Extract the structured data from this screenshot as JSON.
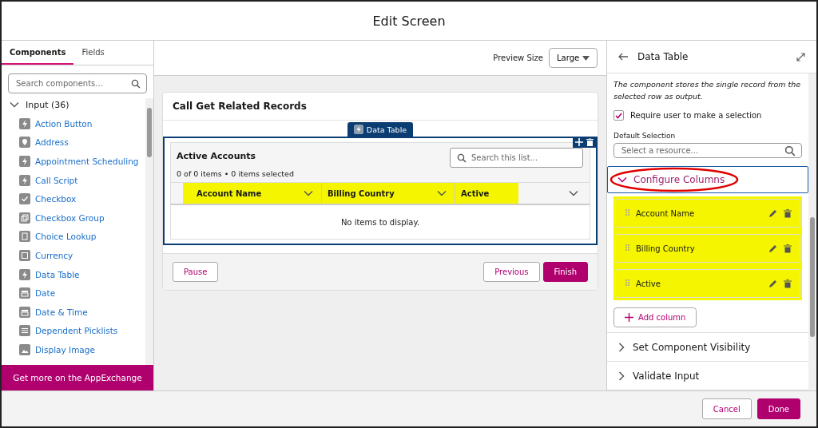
{
  "window": {
    "title": "Edit Screen"
  },
  "tabs": [
    {
      "label": "Components",
      "selected": true
    },
    {
      "label": "Fields",
      "selected": false
    }
  ],
  "sidebar": {
    "search": {
      "placeholder": "Search components..."
    },
    "group": {
      "label": "Input (36)",
      "expanded": true,
      "items": [
        {
          "label": "Action Button",
          "kind": "bolt"
        },
        {
          "label": "Address",
          "kind": "pin"
        },
        {
          "label": "Appointment Scheduling",
          "kind": "bolt"
        },
        {
          "label": "Call Script",
          "kind": "bolt"
        },
        {
          "label": "Checkbox",
          "kind": "check"
        },
        {
          "label": "Checkbox Group",
          "kind": "group"
        },
        {
          "label": "Choice Lookup",
          "kind": "clipboard"
        },
        {
          "label": "Currency",
          "kind": "square"
        },
        {
          "label": "Data Table",
          "kind": "bolt"
        },
        {
          "label": "Date",
          "kind": "calendar"
        },
        {
          "label": "Date & Time",
          "kind": "calendar"
        },
        {
          "label": "Dependent Picklists",
          "kind": "list"
        },
        {
          "label": "Display Image",
          "kind": "image"
        }
      ]
    },
    "footer": "Get more on the AppExchange"
  },
  "preview": {
    "label": "Preview Size",
    "value": "Large"
  },
  "screen": {
    "title": "Call Get Related Records",
    "badge": "Data Table",
    "table": {
      "title": "Active Accounts",
      "summary": "0 of 0 items • 0 items selected",
      "search": {
        "placeholder": "Search this list..."
      },
      "columns": [
        {
          "label": "Account Name",
          "highlighted": true
        },
        {
          "label": "Billing Country",
          "highlighted": true
        },
        {
          "label": "Active",
          "highlighted": true
        }
      ],
      "empty": "No items to display."
    },
    "buttons": [
      {
        "label": "Pause",
        "kind": "outline"
      },
      {
        "label": "Previous",
        "kind": "outline"
      },
      {
        "label": "Finish",
        "kind": "brand"
      }
    ]
  },
  "properties": {
    "title": "Data Table",
    "note": "The component stores the single record from the selected row as output.",
    "require": {
      "label": "Require user to make a selection",
      "checked": true
    },
    "default_selection": {
      "label": "Default Selection",
      "placeholder": "Select a resource..."
    },
    "sections": [
      {
        "label": "Configure Columns",
        "expanded": true,
        "circled": true,
        "columns": [
          {
            "label": "Account Name",
            "highlighted": true
          },
          {
            "label": "Billing Country",
            "highlighted": true
          },
          {
            "label": "Active",
            "highlighted": true
          }
        ],
        "add": "Add column"
      },
      {
        "label": "Set Component Visibility",
        "expanded": false,
        "circled": false
      },
      {
        "label": "Validate Input",
        "expanded": false,
        "circled": false
      }
    ]
  },
  "footer_buttons": [
    {
      "label": "Cancel",
      "kind": "outline"
    },
    {
      "label": "Done",
      "kind": "brand"
    }
  ]
}
